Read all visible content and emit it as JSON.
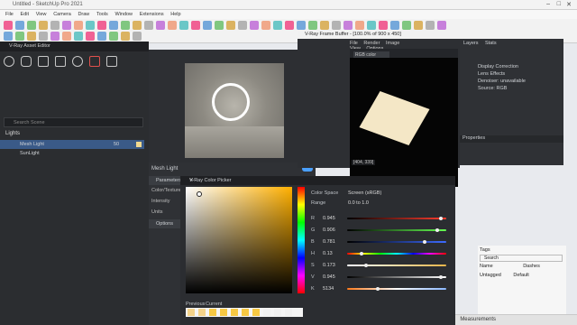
{
  "sketchup": {
    "title": "Untitled - SketchUp Pro 2021",
    "menu": [
      "File",
      "Edit",
      "View",
      "Camera",
      "Draw",
      "Tools",
      "Window",
      "Extensions",
      "Help"
    ],
    "status_label": "Measurements"
  },
  "asset_editor": {
    "title": "V-Ray Asset Editor",
    "search_placeholder": "Search Scene",
    "lights_header": "Lights",
    "lights": [
      {
        "name": "Mesh Light",
        "value": "50"
      },
      {
        "name": "SunLight",
        "value": ""
      }
    ]
  },
  "light_settings": {
    "header": "Mesh Light",
    "parameters_label": "Parameters",
    "rows": [
      "Color/Texture",
      "Intensity",
      "Units"
    ],
    "options_label": "Options"
  },
  "frame_buffer": {
    "title": "V-Ray Frame Buffer - [100.0% of 900 x 450]",
    "menu": [
      "File",
      "Render",
      "Image",
      "View",
      "Options"
    ],
    "channel": "RGB color",
    "coords": "[404, 339]"
  },
  "layers_panel": {
    "tabs": [
      "Layers",
      "Stats"
    ],
    "items": [
      "Display Correction",
      "Lens Effects",
      "Denoiser: unavailable",
      "Source: RGB"
    ],
    "properties_label": "Properties"
  },
  "color_picker": {
    "title": "V-Ray Color Picker",
    "color_space_label": "Color Space",
    "color_space_value": "Screen (sRGB)",
    "range_label": "Range",
    "range_value": "0.0 to 1.0",
    "channels": [
      {
        "k": "R",
        "v": "0.945",
        "pos": 0.945,
        "grad": "linear-gradient(to right,#000,#ff3d2e)"
      },
      {
        "k": "G",
        "v": "0.906",
        "pos": 0.906,
        "grad": "linear-gradient(to right,#000,#65ff52)"
      },
      {
        "k": "B",
        "v": "0.781",
        "pos": 0.781,
        "grad": "linear-gradient(to right,#000,#3d6bff)"
      },
      {
        "k": "H",
        "v": "0.13",
        "pos": 0.13,
        "grad": "linear-gradient(to right,#f00,#ff0,#0f0,#0ff,#00f,#f0f,#f00)"
      },
      {
        "k": "S",
        "v": "0.173",
        "pos": 0.173,
        "grad": "linear-gradient(to right,#fff,#e6b54a)"
      },
      {
        "k": "V",
        "v": "0.945",
        "pos": 0.945,
        "grad": "linear-gradient(to right,#000,#fff)"
      },
      {
        "k": "K",
        "v": "5134",
        "pos": 0.3,
        "grad": "linear-gradient(to right,#ff7a1a,#fff,#8bb7ff)"
      }
    ],
    "previous_label": "Previous",
    "current_label": "Current",
    "swatches": [
      "#f3d28a",
      "#f3d28a",
      "#f6c843",
      "#f6c843",
      "#f6c843",
      "#f6c843",
      "#f6c843",
      "#f1f1f1",
      "#f1f1f1",
      "#f1f1f1"
    ]
  },
  "tags_panel": {
    "header": "Tags",
    "search_placeholder": "Search",
    "columns": [
      "Name",
      "Dashes"
    ],
    "untagged": "Untagged",
    "default": "Default"
  }
}
